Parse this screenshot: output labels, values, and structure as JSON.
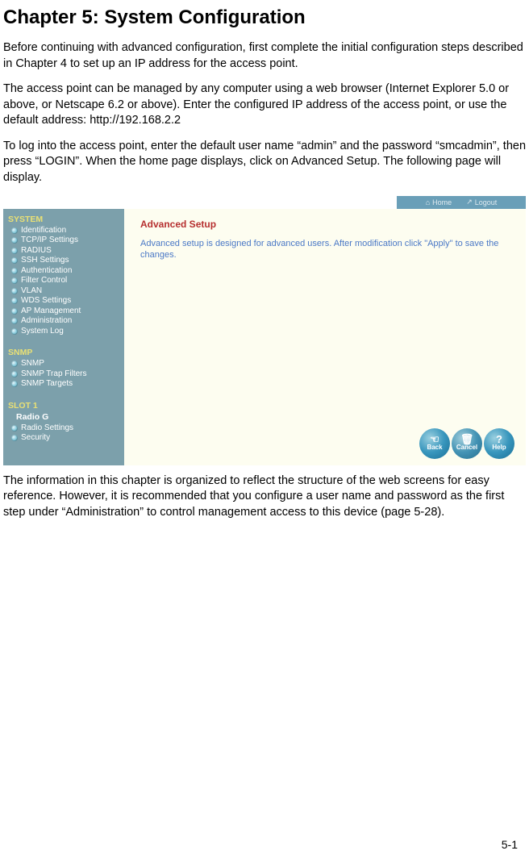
{
  "page": {
    "title": "Chapter 5: System Configuration",
    "para1": "Before continuing with advanced configuration, first complete the initial configuration steps described in Chapter 4 to set up an IP address for the access point.",
    "para2": "The access point can be managed by any computer using a web browser (Internet Explorer 5.0 or above, or Netscape 6.2 or above). Enter the configured IP address of the access point, or use the default address: http://192.168.2.2",
    "para3": "To log into the access point, enter the default user name “admin” and the password “smcadmin”, then press “LOGIN”. When the home page displays, click on Advanced Setup. The following page will display.",
    "para4": "The information in this chapter is organized to reflect the structure of the web screens for easy reference. However, it is recommended that you configure a user name and password as the first step under “Administration” to control management access to this device (page 5-28).",
    "page_number": "5-1"
  },
  "topbar": {
    "home": "Home",
    "logout": "Logout"
  },
  "sidebar": {
    "system_heading": "SYSTEM",
    "system_items": [
      {
        "label": "Identification"
      },
      {
        "label": "TCP/IP Settings"
      },
      {
        "label": "RADIUS"
      },
      {
        "label": "SSH Settings"
      },
      {
        "label": "Authentication"
      },
      {
        "label": "Filter Control"
      },
      {
        "label": "VLAN"
      },
      {
        "label": "WDS Settings"
      },
      {
        "label": "AP Management"
      },
      {
        "label": "Administration"
      },
      {
        "label": "System Log"
      }
    ],
    "snmp_heading": "SNMP",
    "snmp_items": [
      {
        "label": "SNMP"
      },
      {
        "label": "SNMP Trap Filters"
      },
      {
        "label": "SNMP Targets"
      }
    ],
    "slot_heading": "SLOT 1",
    "slot_subheading": "Radio G",
    "slot_items": [
      {
        "label": "Radio Settings"
      },
      {
        "label": "Security"
      }
    ]
  },
  "main": {
    "title": "Advanced Setup",
    "desc": "Advanced setup is designed for advanced users. After modification click \"Apply\" to save the changes."
  },
  "buttons": {
    "back": "Back",
    "cancel": "Cancel",
    "help": "Help"
  }
}
